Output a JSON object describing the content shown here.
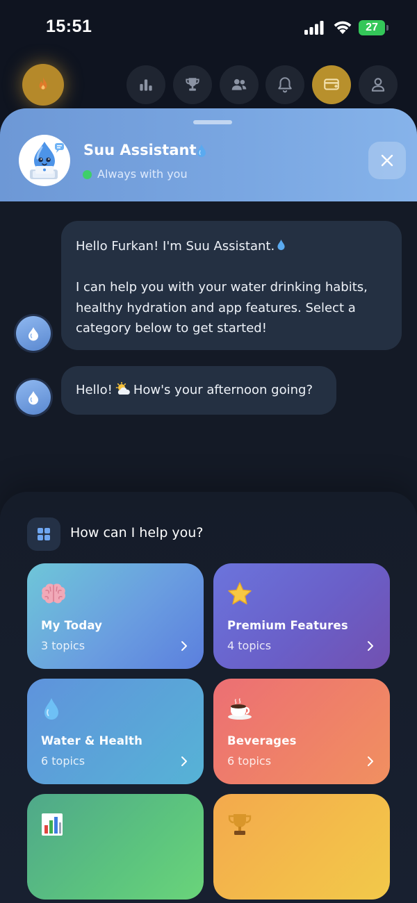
{
  "status_bar": {
    "time": "15:51",
    "battery": "27"
  },
  "nav": {
    "items": [
      {
        "icon": "flame-icon",
        "label": "Streak"
      },
      {
        "icon": "bar-chart-icon",
        "label": "Statistics"
      },
      {
        "icon": "trophy-icon",
        "label": "Achievements"
      },
      {
        "icon": "people-icon",
        "label": "Friends"
      },
      {
        "icon": "bell-icon",
        "label": "Notifications"
      },
      {
        "icon": "premium-card-icon",
        "label": "Premium"
      },
      {
        "icon": "person-icon",
        "label": "Profile"
      }
    ]
  },
  "assistant": {
    "name": "Suu Assistant",
    "status": "Always with you"
  },
  "messages": [
    {
      "line1": "Hello Furkan! I'm Suu Assistant.",
      "line2": "I can help you with your water drinking habits,",
      "line3": "healthy hydration and app features. Select a",
      "line4": "category below to get started!"
    },
    {
      "before": "Hello!",
      "after": "How's your afternoon going?"
    }
  ],
  "help": {
    "title": "How can I help you?",
    "cards": [
      {
        "title": "My Today",
        "subtitle": "3 topics",
        "icon": "brain-icon"
      },
      {
        "title": "Premium Features",
        "subtitle": "4 topics",
        "icon": "star-icon"
      },
      {
        "title": "Water & Health",
        "subtitle": "6 topics",
        "icon": "water-drop-icon"
      },
      {
        "title": "Beverages",
        "subtitle": "6 topics",
        "icon": "coffee-icon"
      },
      {
        "title": "",
        "subtitle": "",
        "icon": "bar-chart-icon"
      },
      {
        "title": "",
        "subtitle": "",
        "icon": "trophy-icon"
      }
    ]
  },
  "colors": {
    "background": "#0f1420",
    "header_gradient_start": "#6d98d6",
    "bubble": "#243042",
    "online": "#3ecf6a",
    "battery": "#34c759"
  }
}
